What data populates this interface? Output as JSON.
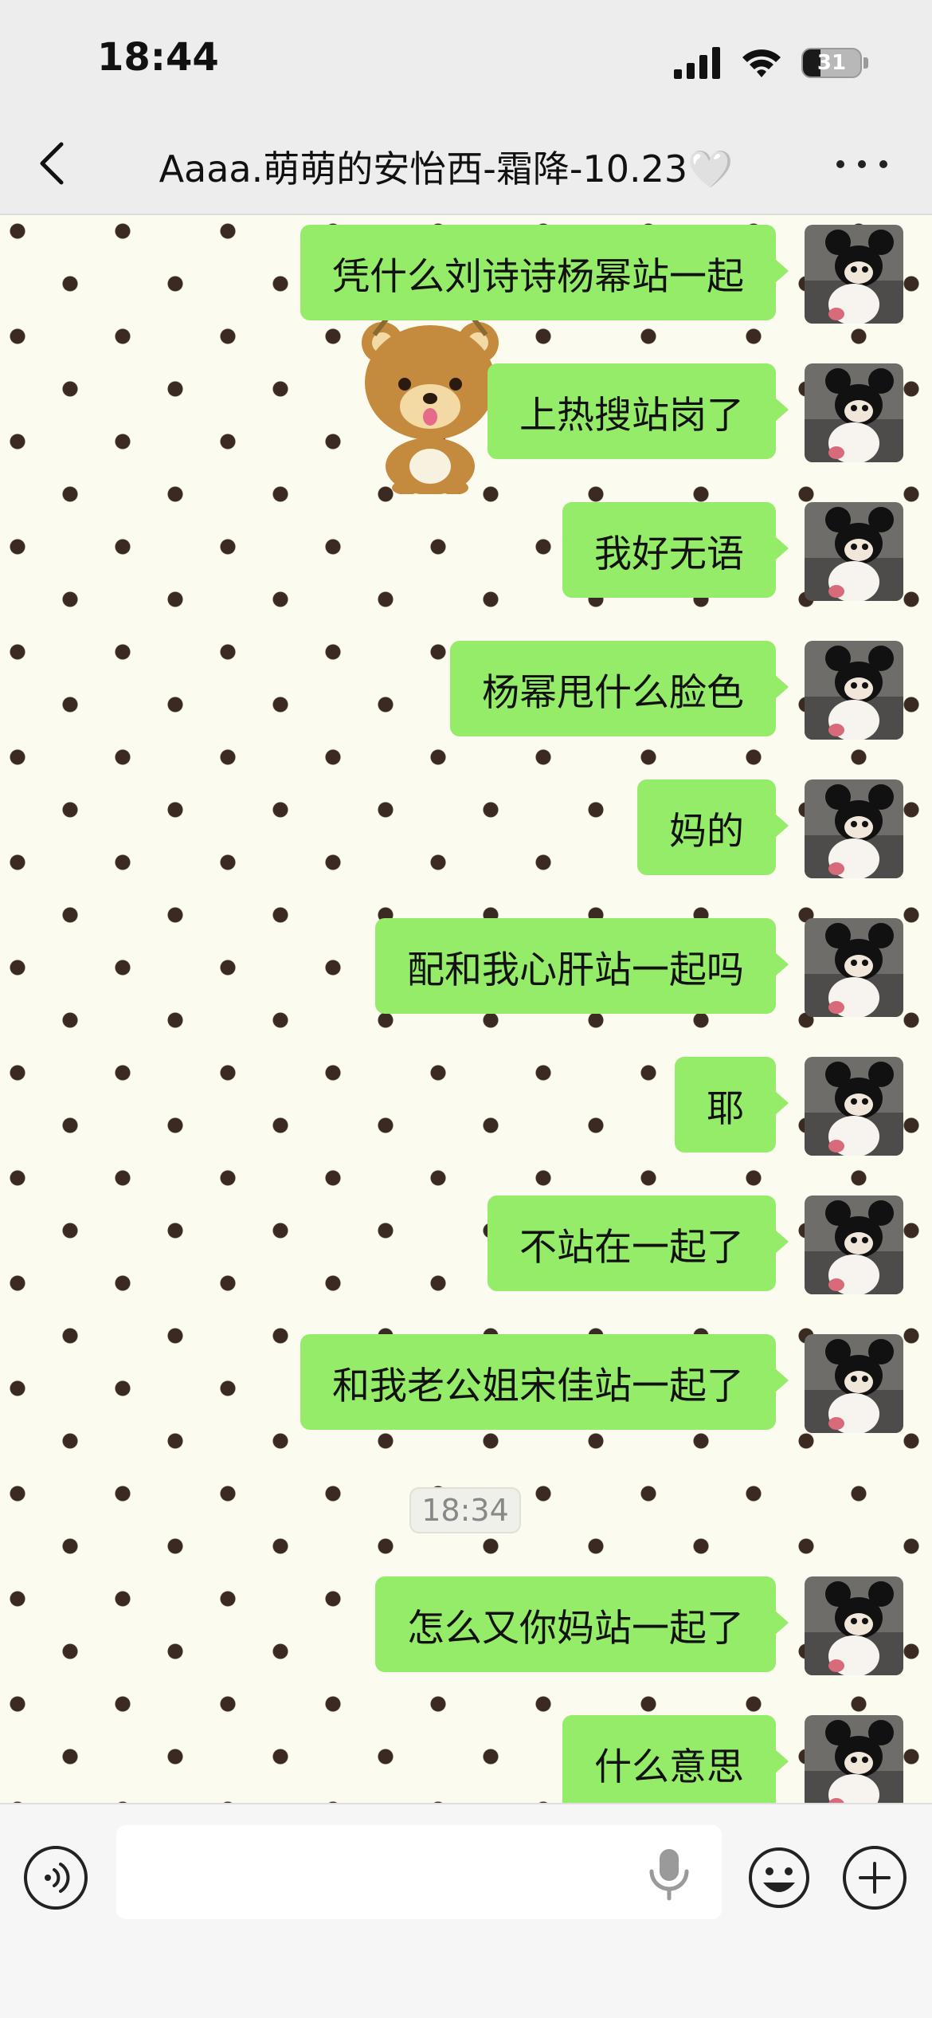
{
  "status_bar": {
    "time": "18:44",
    "battery_level": "31",
    "icons": [
      "signal-icon",
      "wifi-icon",
      "battery-icon"
    ]
  },
  "nav": {
    "title": "Aaaa.萌萌的安怡西-霜降-10.23🤍",
    "icons": [
      "chevron-left-icon",
      "more-icon"
    ]
  },
  "messages": [
    {
      "type": "text",
      "direction": "outgoing",
      "text": "凭什么刘诗诗杨幂站一起"
    },
    {
      "type": "text",
      "direction": "outgoing",
      "text": "上热搜站岗了"
    },
    {
      "type": "text",
      "direction": "outgoing",
      "text": "我好无语"
    },
    {
      "type": "text",
      "direction": "outgoing",
      "text": "杨幂甩什么脸色"
    },
    {
      "type": "text",
      "direction": "outgoing",
      "text": "妈的"
    },
    {
      "type": "text",
      "direction": "outgoing",
      "text": "配和我心肝站一起吗"
    },
    {
      "type": "text",
      "direction": "outgoing",
      "text": "耶"
    },
    {
      "type": "text",
      "direction": "outgoing",
      "text": "不站在一起了"
    },
    {
      "type": "text",
      "direction": "outgoing",
      "text": "和我老公姐宋佳站一起了"
    },
    {
      "type": "time",
      "text": "18:34"
    },
    {
      "type": "text",
      "direction": "outgoing",
      "text": "怎么又你妈站一起了"
    },
    {
      "type": "text",
      "direction": "outgoing",
      "text": "什么意思"
    }
  ],
  "input_bar": {
    "value": "",
    "icons": [
      "voice-icon",
      "mic-icon",
      "emoji-icon",
      "plus-icon"
    ]
  },
  "colors": {
    "bubble": "#95ec69",
    "chat_background": "#fcfbef",
    "dots": "#3b2a22",
    "nav_background": "#ededed"
  }
}
